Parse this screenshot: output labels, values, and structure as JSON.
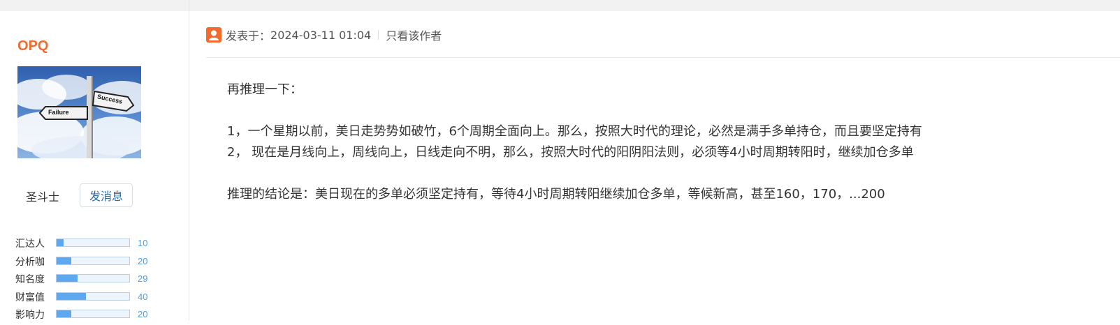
{
  "author": {
    "name": "OPQ",
    "avatar_signs": [
      "Failure",
      "Success"
    ],
    "rank": "圣斗士",
    "message_button": "发消息",
    "stats": [
      {
        "label": "汇达人",
        "value": "10",
        "fraction": 0.1
      },
      {
        "label": "分析咖",
        "value": "20",
        "fraction": 0.2
      },
      {
        "label": "知名度",
        "value": "29",
        "fraction": 0.29
      },
      {
        "label": "财富值",
        "value": "40",
        "fraction": 0.4
      },
      {
        "label": "影响力",
        "value": "20",
        "fraction": 0.2
      }
    ]
  },
  "post": {
    "posted_label": "发表于：",
    "posted_time": "2024-03-11 01:04",
    "only_author_label": "只看该作者",
    "lines": [
      "再推理一下：",
      "",
      "1，一个星期以前，美日走势势如破竹，6个周期全面向上。那么，按照大时代的理论，必然是满手多单持仓，而且要坚定持有",
      "2， 现在是月线向上，周线向上，日线走向不明，那么，按照大时代的阳阴阳法则，必须等4小时周期转阳时，继续加仓多单",
      "",
      "推理的结论是：美日现在的多单必须坚定持有，等待4小时周期转阳继续加仓多单，等候新高，甚至160，170，...200"
    ]
  },
  "colors": {
    "username": "#f26a2e",
    "stat_fill": "#5ea8ef",
    "stat_value": "#4d9de0",
    "icon": "#f26a2e"
  }
}
